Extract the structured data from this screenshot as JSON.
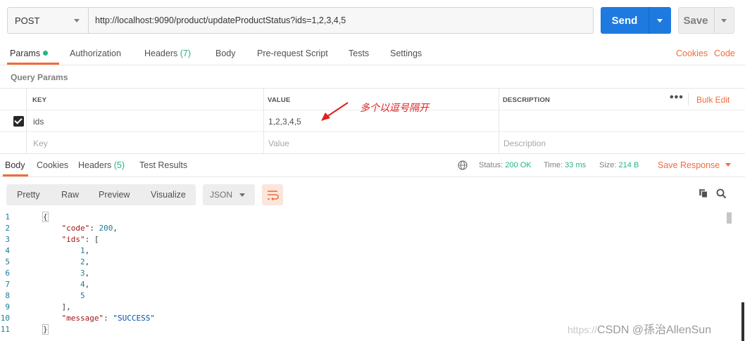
{
  "request": {
    "method": "POST",
    "url": "http://localhost:9090/product/updateProductStatus?ids=1,2,3,4,5",
    "send_label": "Send",
    "save_label": "Save"
  },
  "request_tabs": {
    "params": "Params",
    "authorization": "Authorization",
    "headers": "Headers",
    "headers_count": "(7)",
    "body": "Body",
    "prerequest": "Pre-request Script",
    "tests": "Tests",
    "settings": "Settings",
    "cookies": "Cookies",
    "code": "Code"
  },
  "query_params": {
    "title": "Query Params",
    "columns": {
      "key": "KEY",
      "value": "VALUE",
      "description": "DESCRIPTION"
    },
    "bulk_edit": "Bulk Edit",
    "rows": [
      {
        "key": "ids",
        "value": "1,2,3,4,5",
        "description": ""
      }
    ],
    "placeholders": {
      "key": "Key",
      "value": "Value",
      "description": "Description"
    }
  },
  "annotation": {
    "text": "多个以逗号隔开",
    "color": "#e02020"
  },
  "response_tabs": {
    "body": "Body",
    "cookies": "Cookies",
    "headers": "Headers",
    "headers_count": "(5)",
    "test_results": "Test Results",
    "status_label": "Status:",
    "status_value": "200 OK",
    "time_label": "Time:",
    "time_value": "33 ms",
    "size_label": "Size:",
    "size_value": "214 B",
    "save_response": "Save Response"
  },
  "view": {
    "pretty": "Pretty",
    "raw": "Raw",
    "preview": "Preview",
    "visualize": "Visualize",
    "format": "JSON"
  },
  "response_body": {
    "code_key": "\"code\"",
    "code_value": "200",
    "ids_key": "\"ids\"",
    "ids": [
      "1",
      "2",
      "3",
      "4",
      "5"
    ],
    "message_key": "\"message\"",
    "message_value": "\"SUCCESS\""
  },
  "line_numbers": [
    "1",
    "2",
    "3",
    "4",
    "5",
    "6",
    "7",
    "8",
    "9",
    "10",
    "11"
  ],
  "watermark": {
    "prefix": "https://",
    "text": "CSDN @孫治AllenSun"
  },
  "colors": {
    "accent_orange": "#f26b3a",
    "send_blue": "#1f7ae0",
    "success_green": "#26b47f"
  }
}
